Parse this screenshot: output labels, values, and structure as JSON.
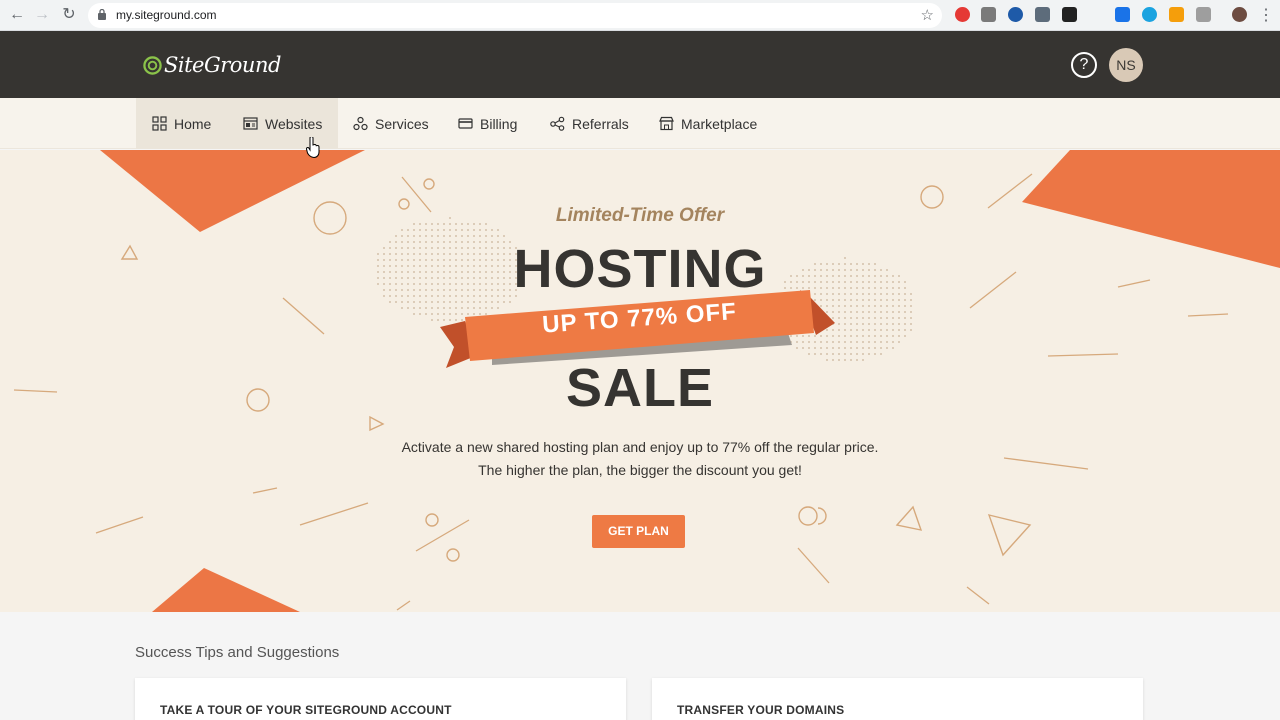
{
  "browser": {
    "url": "my.siteground.com"
  },
  "header": {
    "logo_text": "SiteGround",
    "help_label": "?",
    "avatar_initials": "NS"
  },
  "nav": {
    "items": [
      {
        "label": "Home",
        "icon": "grid-icon"
      },
      {
        "label": "Websites",
        "icon": "browser-window-icon"
      },
      {
        "label": "Services",
        "icon": "services-icon"
      },
      {
        "label": "Billing",
        "icon": "credit-card-icon"
      },
      {
        "label": "Referrals",
        "icon": "share-icon"
      },
      {
        "label": "Marketplace",
        "icon": "store-icon"
      }
    ]
  },
  "hero": {
    "offer_tag": "Limited-Time Offer",
    "headline_top": "HOSTING",
    "ribbon_text": "UP TO 77% OFF",
    "headline_bottom": "SALE",
    "description_line1": "Activate a new shared hosting plan and enjoy up to 77% off the regular price.",
    "description_line2": "The higher the plan, the bigger the discount you get!",
    "cta_label": "GET PLAN"
  },
  "tips": {
    "title": "Success Tips and Suggestions",
    "cards": [
      {
        "title": "TAKE A TOUR OF YOUR SITEGROUND ACCOUNT"
      },
      {
        "title": "TRANSFER YOUR DOMAINS"
      }
    ]
  },
  "colors": {
    "accent": "#ee7a44",
    "header_bg": "#363431",
    "hero_bg": "#f6efe4"
  }
}
